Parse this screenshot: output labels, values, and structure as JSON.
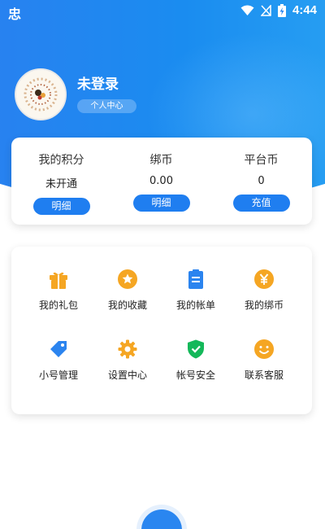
{
  "status_bar": {
    "time": "4:44",
    "app_icon": "忠"
  },
  "profile": {
    "username": "未登录",
    "personal_center": "个人中心"
  },
  "points": [
    {
      "label": "我的积分",
      "value": "未开通",
      "button": "明细"
    },
    {
      "label": "绑币",
      "value": "0.00",
      "button": "明细"
    },
    {
      "label": "平台币",
      "value": "0",
      "button": "充值"
    }
  ],
  "menu": [
    {
      "label": "我的礼包",
      "icon": "gift-icon",
      "color": "#f5a623"
    },
    {
      "label": "我的收藏",
      "icon": "star-icon",
      "color": "#f5a623"
    },
    {
      "label": "我的帐单",
      "icon": "bill-icon",
      "color": "#2b84ef"
    },
    {
      "label": "我的绑币",
      "icon": "yuan-coin-icon",
      "color": "#f5a623"
    },
    {
      "label": "小号管理",
      "icon": "tag-icon",
      "color": "#2b84ef"
    },
    {
      "label": "设置中心",
      "icon": "gear-icon",
      "color": "#f5a623"
    },
    {
      "label": "帐号安全",
      "icon": "shield-icon",
      "color": "#14b85a"
    },
    {
      "label": "联系客服",
      "icon": "smile-icon",
      "color": "#f5a623"
    }
  ],
  "colors": {
    "header_blue": "#1a8cf0",
    "pill_blue": "#1f7ef0",
    "accent_orange": "#f5a623"
  }
}
